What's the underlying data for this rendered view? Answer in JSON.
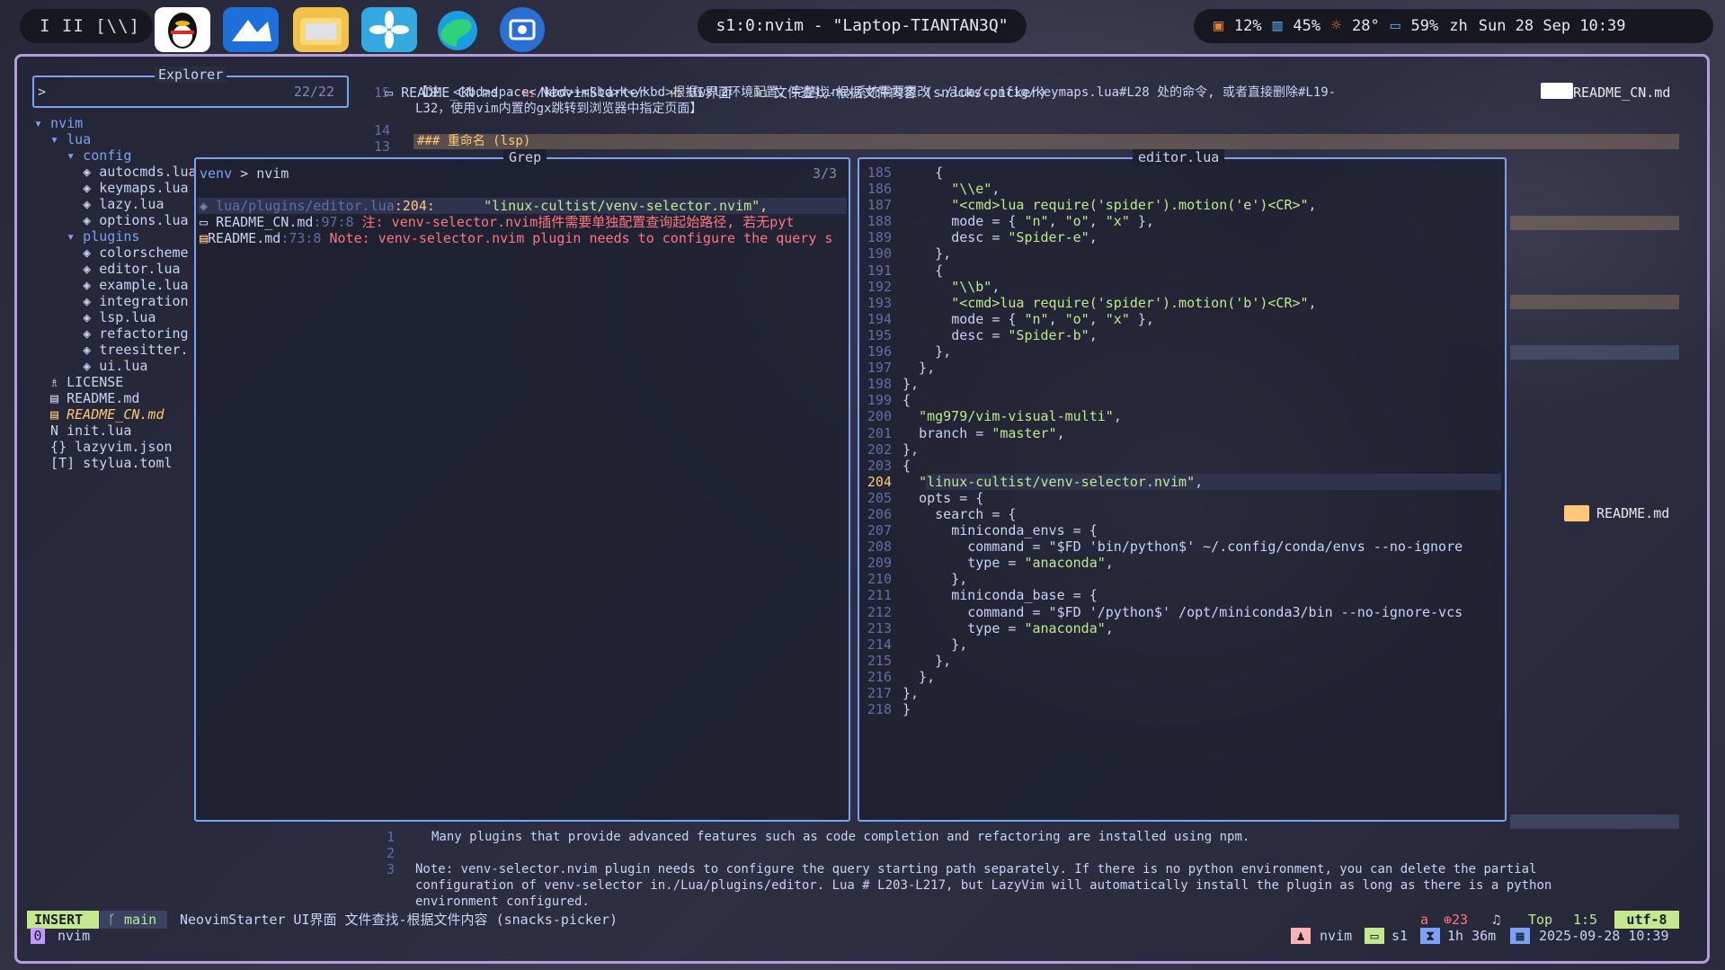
{
  "topbar": {
    "workspaces": "I II [\\\\]",
    "window_title": "s1:0:nvim - \"Laptop-TIANTAN3Q\"",
    "cpu": "12%",
    "mem": "45%",
    "temp": "28°",
    "battery": "59%",
    "lang": "zh",
    "datetime": "Sun 28 Sep 10:39"
  },
  "breadcrumb": {
    "file": "README_CN.md",
    "h1": "NeovimStarter",
    "h2": "UI界面",
    "h3": "文件查找-根据文件内容 (snacks-picker)"
  },
  "doc": {
    "ln15": "15",
    "line15": "【注：<kbd>space</kbd>+<kbd>k</kbd>根据wsl2环境配置，完整Linux系统需要更改 ./lua/config/keymaps.lua#L28 处的命令, 或者直接删除#L19-",
    "line15b": "L32，使用vim内置的gx跳转到浏览器中指定页面】",
    "ln14": "14",
    "ln13": "13",
    "line13": "### 重命名 (lsp)",
    "right_file_tag": "README_CN.md",
    "right_file_tag2": "README.md"
  },
  "explorer": {
    "title": "Explorer",
    "prompt": ">",
    "count": "22/22",
    "tree": [
      "▾ nvim",
      "  ▾ lua",
      "    ▾ config",
      "      ◈ autocmds.lua",
      "      ◈ keymaps.lua",
      "      ◈ lazy.lua",
      "      ◈ options.lua",
      "    ▾ plugins",
      "      ◈ colorscheme",
      "      ◈ editor.lua",
      "      ◈ example.lua",
      "      ◈ integration",
      "      ◈ lsp.lua",
      "      ◈ refactoring",
      "      ◈ treesitter.",
      "      ◈ ui.lua",
      "  ♗ LICENSE",
      "  ▤ README.md",
      "  ▤ README_CN.md",
      "  N init.lua",
      "  {} lazyvim.json",
      "  [T] stylua.toml"
    ]
  },
  "grep": {
    "title": "Grep",
    "query_a": "venv",
    "query_b": "nvim",
    "count": "3/3",
    "results": [
      {
        "file": "lua/plugins/editor.lua",
        "loc": ":204:",
        "text": "\"linux-cultist/venv-selector.nvim\","
      },
      {
        "file": "README_CN.md",
        "loc": ":97:8",
        "text": "注: venv-selector.nvim插件需要单独配置查询起始路径, 若无pyt"
      },
      {
        "file": "README.md",
        "loc": ":73:8",
        "text": "Note: venv-selector.nvim plugin needs to configure the query s"
      }
    ]
  },
  "preview": {
    "title": "editor.lua",
    "current_line": 204,
    "lines": [
      {
        "n": 185,
        "t": "    {"
      },
      {
        "n": 186,
        "t": "      \"\\\\e\","
      },
      {
        "n": 187,
        "t": "      \"<cmd>lua require('spider').motion('e')<CR>\","
      },
      {
        "n": 188,
        "t": "      mode = { \"n\", \"o\", \"x\" },"
      },
      {
        "n": 189,
        "t": "      desc = \"Spider-e\","
      },
      {
        "n": 190,
        "t": "    },"
      },
      {
        "n": 191,
        "t": "    {"
      },
      {
        "n": 192,
        "t": "      \"\\\\b\","
      },
      {
        "n": 193,
        "t": "      \"<cmd>lua require('spider').motion('b')<CR>\","
      },
      {
        "n": 194,
        "t": "      mode = { \"n\", \"o\", \"x\" },"
      },
      {
        "n": 195,
        "t": "      desc = \"Spider-b\","
      },
      {
        "n": 196,
        "t": "    },"
      },
      {
        "n": 197,
        "t": "  },"
      },
      {
        "n": 198,
        "t": "},"
      },
      {
        "n": 199,
        "t": "{"
      },
      {
        "n": 200,
        "t": "  \"mg979/vim-visual-multi\","
      },
      {
        "n": 201,
        "t": "  branch = \"master\","
      },
      {
        "n": 202,
        "t": "},"
      },
      {
        "n": 203,
        "t": "{"
      },
      {
        "n": 204,
        "t": "  \"linux-cultist/venv-selector.nvim\","
      },
      {
        "n": 205,
        "t": "  opts = {"
      },
      {
        "n": 206,
        "t": "    search = {"
      },
      {
        "n": 207,
        "t": "      miniconda_envs = {"
      },
      {
        "n": 208,
        "t": "        command = \"$FD 'bin/python$' ~/.config/conda/envs --no-ignore"
      },
      {
        "n": 209,
        "t": "        type = \"anaconda\","
      },
      {
        "n": 210,
        "t": "      },"
      },
      {
        "n": 211,
        "t": "      miniconda_base = {"
      },
      {
        "n": 212,
        "t": "        command = \"$FD '/python$' /opt/miniconda3/bin --no-ignore-vcs"
      },
      {
        "n": 213,
        "t": "        type = \"anaconda\","
      },
      {
        "n": 214,
        "t": "      },"
      },
      {
        "n": 215,
        "t": "    },"
      },
      {
        "n": 216,
        "t": "  },"
      },
      {
        "n": 217,
        "t": "},"
      },
      {
        "n": 218,
        "t": "}"
      }
    ]
  },
  "bottom_doc": {
    "l1": "Many plugins that provide advanced features such as code completion and refactoring are installed using npm.",
    "l2": "Note: venv-selector.nvim plugin needs to configure the query starting path separately. If there is no python environment, you can delete the partial",
    "l3": "configuration of venv-selector in./Lua/plugins/editor. Lua # L203-L217, but LazyVim will automatically install the plugin as long as there is a python",
    "l4": "environment configured.",
    "ln1": "1",
    "ln2": "2",
    "ln3": "3"
  },
  "statusline": {
    "mode": "INSERT",
    "branch": "main",
    "crumb": "NeovimStarter  UI界面  文件查找-根据文件内容 (snacks-picker)",
    "a": "a",
    "diag": "23",
    "pos_top": "Top",
    "pos": "1:5",
    "enc": "utf-8",
    "buf_num": "0",
    "buf_name": "nvim",
    "tmux_session": "nvim",
    "tmux_win": "s1",
    "uptime": "1h 36m",
    "clock": "2025-09-28 10:39"
  },
  "colors": {
    "accent": "#7aa2f7",
    "border": "#b39ddb",
    "insert": "#c3e88d",
    "string": "#c3e88d",
    "linenr": "#636da6"
  }
}
